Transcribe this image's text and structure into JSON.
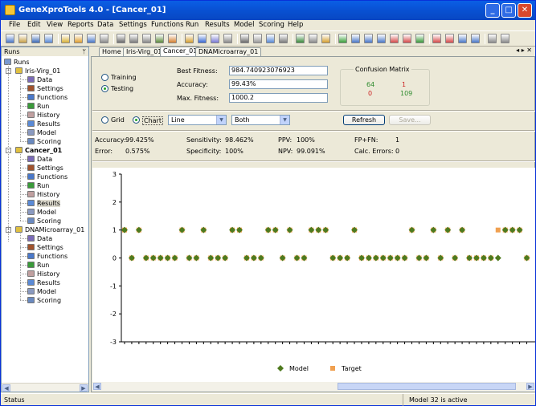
{
  "window": {
    "title": "GeneXproTools 4.0 - [Cancer_01]",
    "buttons": [
      "minimize",
      "maximize",
      "close"
    ]
  },
  "menu": [
    "File",
    "Edit",
    "View",
    "Reports",
    "Data",
    "Settings",
    "Functions",
    "Run",
    "Results",
    "Model",
    "Scoring",
    "Help"
  ],
  "left_panel": {
    "title": "Runs",
    "root": "Runs",
    "runs": [
      {
        "name": "Iris-Virg_01",
        "items": [
          "Data",
          "Settings",
          "Functions",
          "Run",
          "History",
          "Results",
          "Model",
          "Scoring"
        ]
      },
      {
        "name": "Cancer_01",
        "items": [
          "Data",
          "Settings",
          "Functions",
          "Run",
          "History",
          "Results",
          "Model",
          "Scoring"
        ],
        "selected_item": "Results"
      },
      {
        "name": "DNAMicroarray_01",
        "items": [
          "Data",
          "Settings",
          "Functions",
          "Run",
          "History",
          "Results",
          "Model",
          "Scoring"
        ]
      }
    ]
  },
  "tabs": [
    "Home",
    "Iris-Virg_01",
    "Cancer_01",
    "DNAMicroarray_01"
  ],
  "active_tab": "Cancer_01",
  "mode": {
    "training": "Training",
    "testing": "Testing",
    "selected": "Testing"
  },
  "stats": {
    "best_fitness_label": "Best Fitness:",
    "best_fitness": "984.740923076923",
    "accuracy_label": "Accuracy:",
    "accuracy": "99.43%",
    "max_fitness_label": "Max. Fitness:",
    "max_fitness": "1000.2"
  },
  "confusion_matrix": {
    "title": "Confusion Matrix",
    "tp": "64",
    "fn": "1",
    "fp": "0",
    "tn": "109",
    "colors": {
      "correct": "#2E8B2E",
      "wrong": "#CC2222"
    }
  },
  "view": {
    "grid": "Grid",
    "chart": "Chart",
    "selected": "Chart",
    "chart_type": "Line",
    "series": "Both",
    "refresh": "Refresh",
    "save": "Save..."
  },
  "metrics": {
    "accuracy_label": "Accuracy:",
    "accuracy": "99.425%",
    "error_label": "Error:",
    "error": "0.575%",
    "sensitivity_label": "Sensitivity:",
    "sensitivity": "98.462%",
    "specificity_label": "Specificity:",
    "specificity": "100%",
    "ppv_label": "PPV:",
    "ppv": "100%",
    "npv_label": "NPV:",
    "npv": "99.091%",
    "fpfn_label": "FP+FN:",
    "fpfn": "1",
    "calc_errors_label": "Calc. Errors:",
    "calc_errors": "0"
  },
  "status": {
    "left": "Status",
    "right": "Model 32 is active"
  },
  "chart_data": {
    "type": "scatter",
    "ylim": [
      -3,
      3
    ],
    "yticks": [
      -3,
      -2,
      -1,
      0,
      1,
      2,
      3
    ],
    "grid": false,
    "legend": "bottom-center",
    "series": [
      {
        "name": "Model",
        "color": "#4E7A1E",
        "marker": "diamond",
        "values": [
          1,
          0,
          1,
          0,
          0,
          0,
          0,
          0,
          1,
          0,
          0,
          1,
          0,
          0,
          0,
          1,
          1,
          0,
          0,
          0,
          1,
          1,
          0,
          1,
          0,
          0,
          1,
          1,
          1,
          0,
          0,
          0,
          1,
          0,
          0,
          0,
          0,
          0,
          0,
          0,
          1,
          0,
          0,
          1,
          0,
          1,
          0,
          1,
          0,
          0,
          0,
          0,
          0,
          1,
          1,
          1,
          0
        ]
      },
      {
        "name": "Target",
        "color": "#F0A050",
        "marker": "square",
        "values": [
          1,
          0,
          1,
          0,
          0,
          0,
          0,
          0,
          1,
          0,
          0,
          1,
          0,
          0,
          0,
          1,
          1,
          0,
          0,
          0,
          1,
          1,
          0,
          1,
          0,
          0,
          1,
          1,
          1,
          0,
          0,
          0,
          1,
          0,
          0,
          0,
          0,
          0,
          0,
          0,
          1,
          0,
          0,
          1,
          0,
          1,
          0,
          1,
          0,
          0,
          0,
          0,
          1,
          1,
          1,
          1,
          0
        ]
      }
    ]
  }
}
